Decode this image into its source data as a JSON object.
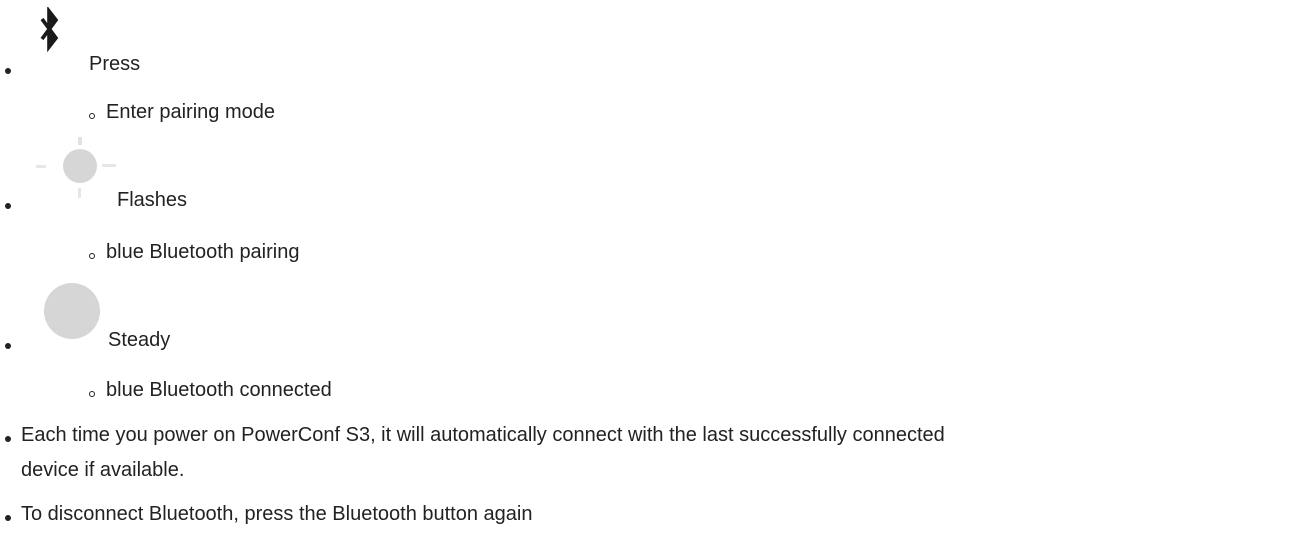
{
  "items": [
    {
      "icon": "bluetooth-icon",
      "label": "Press",
      "sub": "Enter pairing mode"
    },
    {
      "icon": "led-flashing-icon",
      "label": "Flashes",
      "sub": "blue Bluetooth pairing"
    },
    {
      "icon": "led-steady-icon",
      "label": "Steady",
      "sub": "blue Bluetooth connected"
    }
  ],
  "notes": {
    "auto_connect_line1": "Each time you power on PowerConf S3, it will automatically connect with the last successfully connected",
    "auto_connect_line2": "device if available.",
    "disconnect": "To disconnect Bluetooth, press the Bluetooth button again"
  },
  "colors": {
    "text": "#222222",
    "icon_dark": "#1a1a1a",
    "led_gray": "#d6d6d6"
  }
}
